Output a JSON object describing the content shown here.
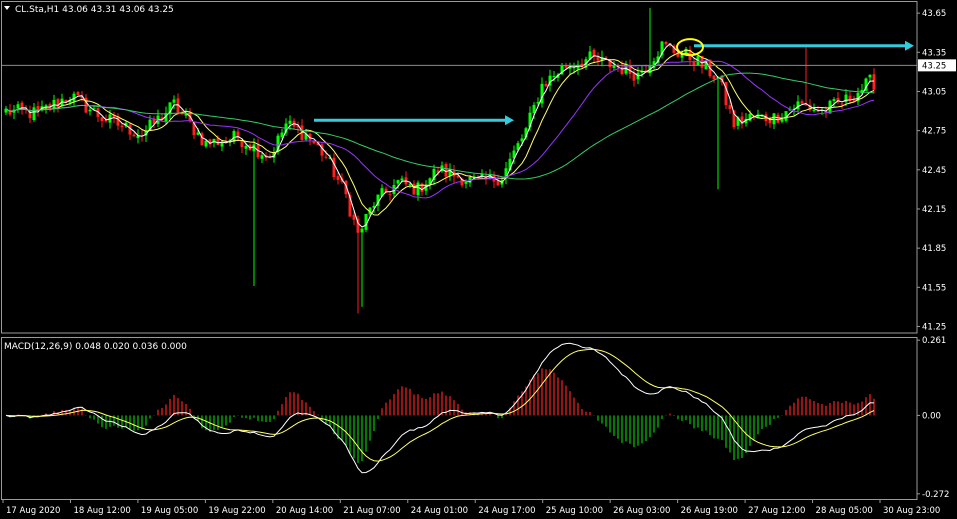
{
  "symbol_info": "CL.Sta,H1  43.06 43.31 43.06 43.25",
  "macd_info": "MACD(12,26,9) 0.048 0.020 0.036 0.000",
  "current_price_label": "43.25",
  "colors": {
    "background": "#000000",
    "bull": "#00ff00",
    "bear": "#ff2020",
    "ma_fast": "#ffffff",
    "ma_mid": "#ffff66",
    "ma_purple": "#9933ff",
    "ma_slow": "#33cc66",
    "arrow": "#33ccdd",
    "ellipse": "#ffff00",
    "macd_hist_pos": "#ff2020",
    "macd_hist_neg": "#00cc00"
  },
  "chart_data": [
    {
      "type": "candlestick",
      "title": "CL.Sta,H1",
      "y_ticks": [
        "43.65",
        "43.35",
        "43.05",
        "42.75",
        "42.45",
        "42.15",
        "41.85",
        "41.55",
        "41.25"
      ],
      "ylim": [
        41.2,
        43.72
      ],
      "x_tick_labels": [
        "17 Aug 2020",
        "18 Aug 12:00",
        "19 Aug 05:00",
        "19 Aug 22:00",
        "20 Aug 14:00",
        "21 Aug 07:00",
        "24 Aug 01:00",
        "24 Aug 17:00",
        "25 Aug 10:00",
        "26 Aug 03:00",
        "26 Aug 19:00",
        "27 Aug 12:00",
        "28 Aug 05:00",
        "30 Aug 23:00"
      ],
      "current_price": 43.25,
      "close_anchors": [
        [
          0,
          42.9
        ],
        [
          8,
          42.88
        ],
        [
          16,
          43.02
        ],
        [
          24,
          42.85
        ],
        [
          34,
          42.72
        ],
        [
          42,
          42.95
        ],
        [
          50,
          42.65
        ],
        [
          58,
          42.7
        ],
        [
          66,
          42.55
        ],
        [
          70,
          42.8
        ],
        [
          75,
          42.72
        ],
        [
          80,
          42.55
        ],
        [
          85,
          42.25
        ],
        [
          88,
          41.95
        ],
        [
          92,
          42.2
        ],
        [
          98,
          42.35
        ],
        [
          103,
          42.3
        ],
        [
          108,
          42.45
        ],
        [
          113,
          42.4
        ],
        [
          118,
          42.35
        ],
        [
          124,
          42.4
        ],
        [
          130,
          42.75
        ],
        [
          134,
          43.1
        ],
        [
          140,
          43.25
        ],
        [
          146,
          43.3
        ],
        [
          152,
          43.25
        ],
        [
          158,
          43.18
        ],
        [
          164,
          43.4
        ],
        [
          172,
          43.3
        ],
        [
          178,
          43.15
        ],
        [
          182,
          42.8
        ],
        [
          186,
          42.85
        ],
        [
          192,
          42.85
        ],
        [
          198,
          42.95
        ],
        [
          204,
          42.9
        ],
        [
          210,
          42.98
        ],
        [
          216,
          43.12
        ]
      ],
      "spikes": [
        {
          "index": 62,
          "low": 41.56
        },
        {
          "index": 88,
          "low": 41.35
        },
        {
          "index": 89,
          "low": 41.4
        },
        {
          "index": 161,
          "high": 43.69
        },
        {
          "index": 178,
          "low": 42.3
        },
        {
          "index": 200,
          "high": 43.4
        }
      ],
      "annotations": [
        {
          "type": "arrow",
          "x_from": 77,
          "x_to": 127,
          "y": 42.83
        },
        {
          "type": "arrow",
          "x_from": 172,
          "x_to": 227,
          "y": 43.4
        },
        {
          "type": "ellipse",
          "x": 171,
          "y": 43.39
        }
      ],
      "moving_average_periods": [
        3,
        8,
        21,
        55
      ]
    },
    {
      "type": "macd",
      "title": "MACD(12,26,9)",
      "params": [
        12,
        26,
        9
      ],
      "values": {
        "macd": 0.048,
        "signal": 0.02,
        "hist": 0.036,
        "zero": 0.0
      },
      "y_ticks": [
        "0.261",
        "0.00",
        "-0.272"
      ],
      "ylim": [
        -0.29,
        0.272
      ]
    }
  ]
}
